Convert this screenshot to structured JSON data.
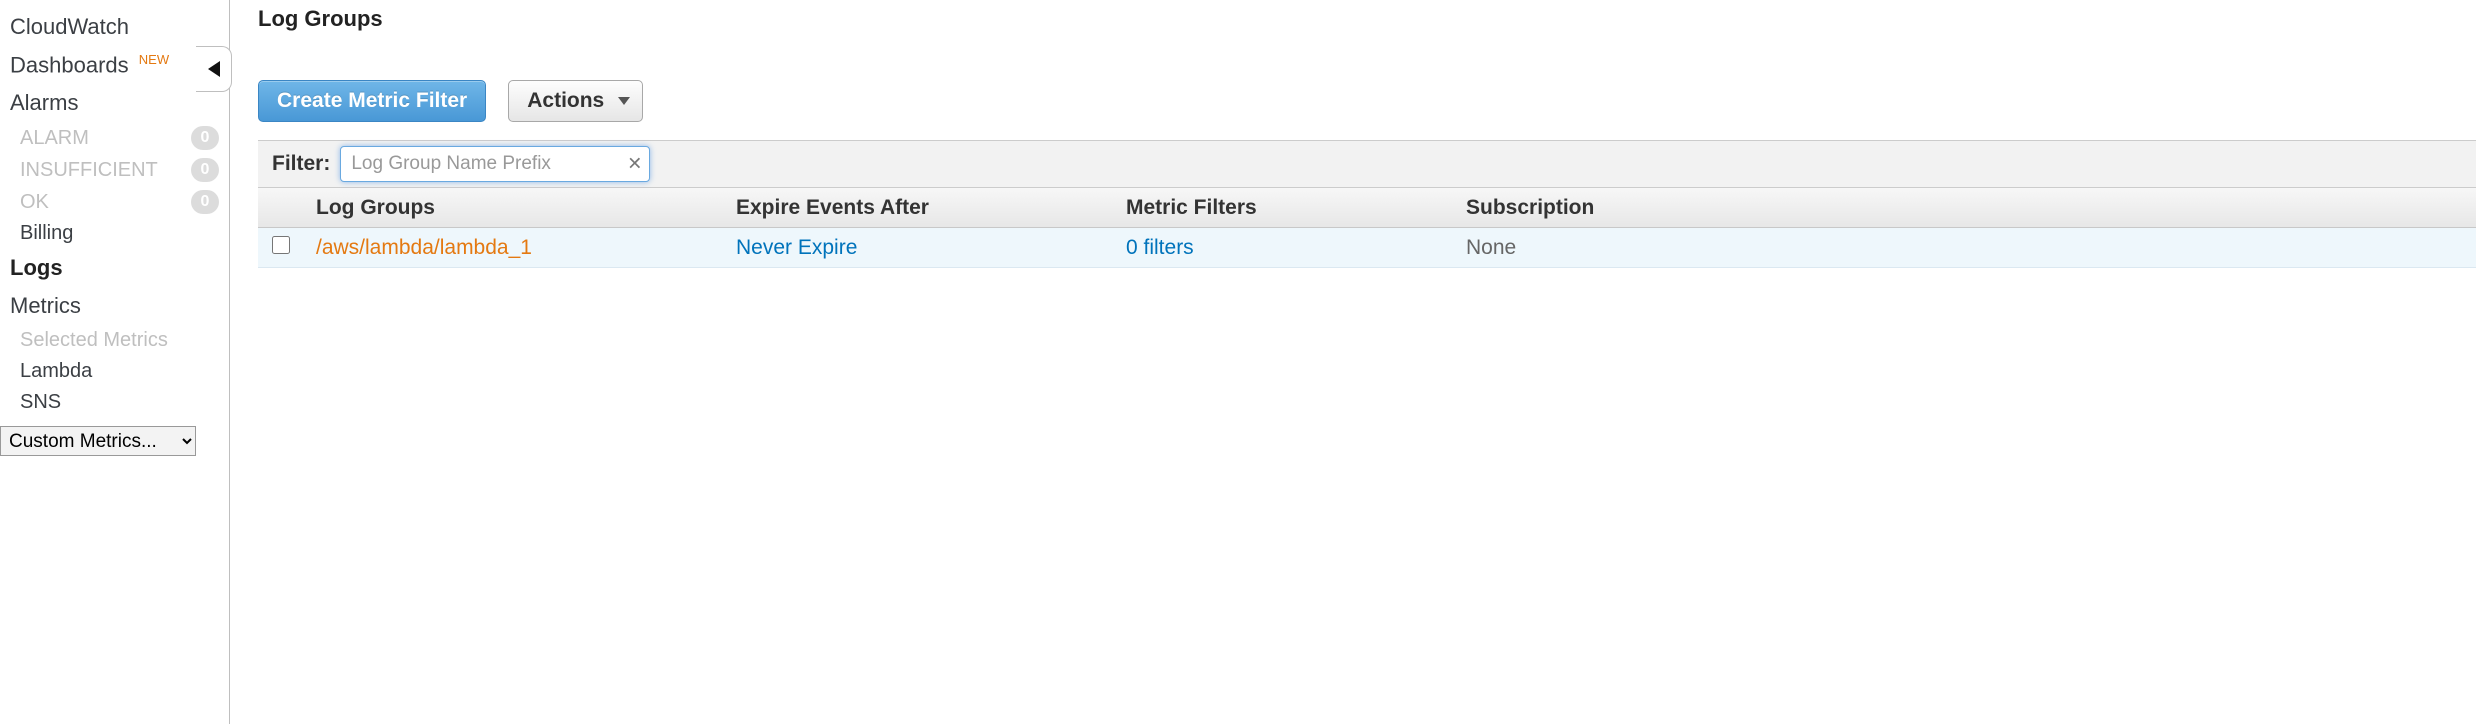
{
  "sidebar": {
    "cloudwatch_label": "CloudWatch",
    "dashboards_label": "Dashboards",
    "dashboards_badge": "NEW",
    "alarms_label": "Alarms",
    "alarm_states": [
      {
        "label": "ALARM",
        "count": "0"
      },
      {
        "label": "INSUFFICIENT",
        "count": "0"
      },
      {
        "label": "OK",
        "count": "0"
      }
    ],
    "billing_label": "Billing",
    "logs_label": "Logs",
    "metrics_label": "Metrics",
    "selected_metrics_label": "Selected Metrics",
    "lambda_label": "Lambda",
    "sns_label": "SNS",
    "custom_metrics_label": "Custom Metrics..."
  },
  "main": {
    "title": "Log Groups",
    "create_btn": "Create Metric Filter",
    "actions_btn": "Actions",
    "filter_label": "Filter:",
    "filter_placeholder": "Log Group Name Prefix",
    "filter_value": "",
    "columns": {
      "log_groups": "Log Groups",
      "expire": "Expire Events After",
      "metric_filters": "Metric Filters",
      "subscriptions": "Subscription"
    },
    "rows": [
      {
        "name": "/aws/lambda/lambda_1",
        "expire": "Never Expire",
        "filters": "0 filters",
        "subscriptions": "None"
      }
    ]
  }
}
